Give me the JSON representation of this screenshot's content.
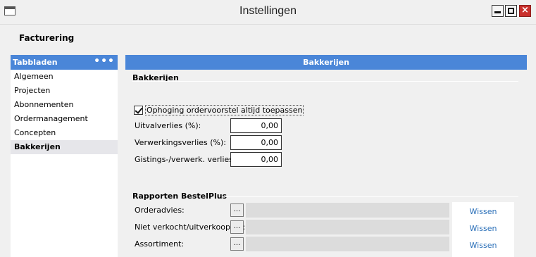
{
  "window": {
    "title": "Instellingen"
  },
  "section": {
    "title": "Facturering"
  },
  "sidebar": {
    "header": "Tabbladen",
    "menu_glyph": "•••",
    "items": [
      {
        "label": "Algemeen"
      },
      {
        "label": "Projecten"
      },
      {
        "label": "Abonnementen"
      },
      {
        "label": "Ordermanagement"
      },
      {
        "label": "Concepten"
      },
      {
        "label": "Bakkerijen",
        "active": true
      }
    ]
  },
  "content": {
    "header": "Bakkerijen",
    "group_bakkerijen": {
      "title": "Bakkerijen",
      "checkbox": {
        "label": "Ophoging ordervoorstel altijd toepassen",
        "checked": true
      },
      "fields": [
        {
          "label": "Uitvalverlies (%):",
          "value": "0,00"
        },
        {
          "label": "Verwerkingsverlies (%):",
          "value": "0,00"
        },
        {
          "label": "Gistings-/verwerk. verlies (%)",
          "value": "0,00"
        }
      ]
    },
    "group_rapporten": {
      "title": "Rapporten BestelPlus",
      "rows": [
        {
          "label": "Orderadvies:",
          "button": "...",
          "value": "",
          "clear": "Wissen"
        },
        {
          "label": "Niet verkocht/uitverkooptijd:",
          "button": "...",
          "value": "",
          "clear": "Wissen"
        },
        {
          "label": "Assortiment:",
          "button": "...",
          "value": "",
          "clear": "Wissen"
        }
      ]
    }
  },
  "colors": {
    "accent": "#4a86d8",
    "link": "#2a6fb8",
    "close": "#c9302c"
  }
}
